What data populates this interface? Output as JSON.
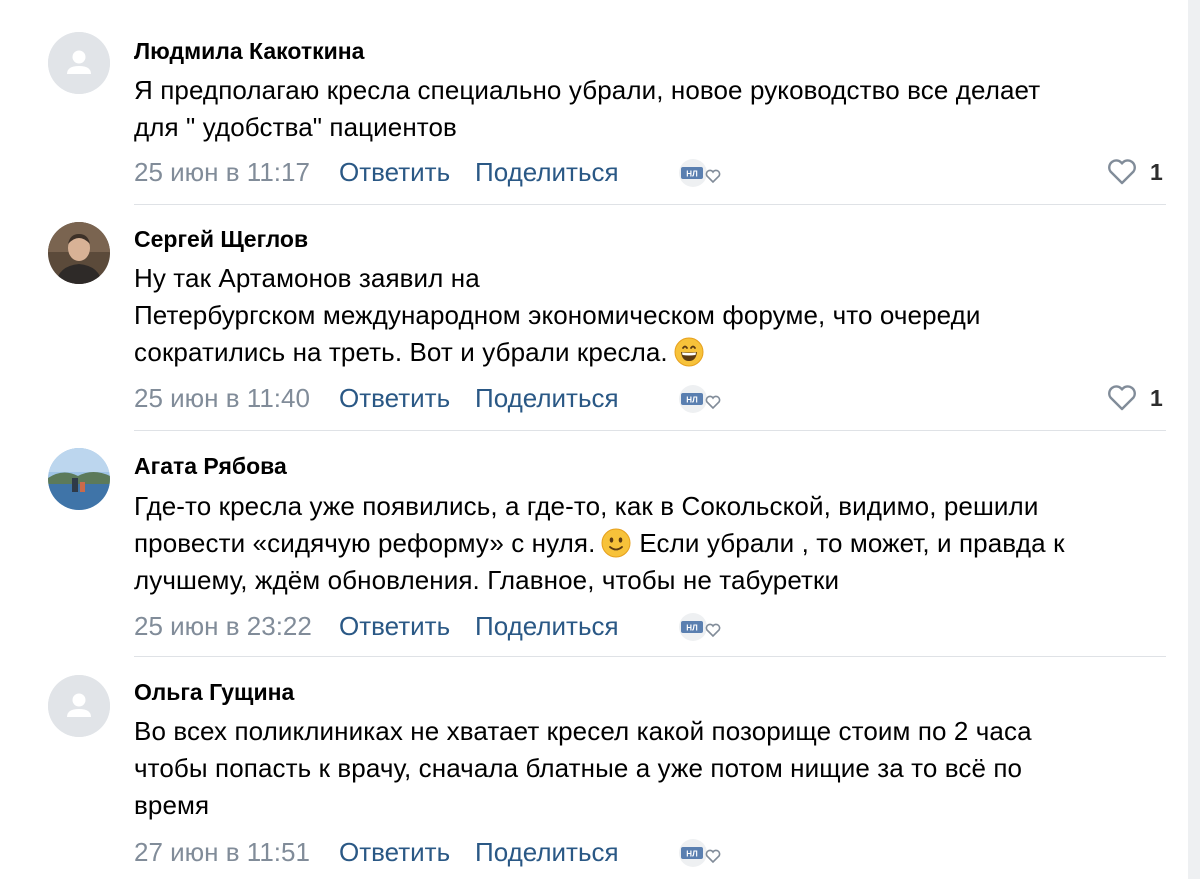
{
  "comments": [
    {
      "author": "Людмила Какоткина",
      "avatar": "default-avatar-icon",
      "lines": [
        "Я предполагаю кресла специально убрали, новое руководство все делает",
        "для \" удобства\" пациентов"
      ],
      "date": "25 июн в 11:17",
      "reply_label": "Ответить",
      "share_label": "Поделиться",
      "likes": "1"
    },
    {
      "author": "Сергей Щеглов",
      "avatar": "user-photo-avatar",
      "lines": [
        "Ну так Артамонов заявил на",
        "Петербургском международном экономическом форуме, что очереди",
        "сократились на треть. Вот и убрали кресла."
      ],
      "emoji": "grinning-face-emoji",
      "date": "25 июн в 11:40",
      "reply_label": "Ответить",
      "share_label": "Поделиться",
      "likes": "1"
    },
    {
      "author": "Агата Рябова",
      "avatar": "landscape-photo-avatar",
      "lines": [
        "Где-то кресла уже появились, а где-то, как в Сокольской, видимо, решили",
        "провести «сидячую реформу» с нуля.",
        "лучшему, ждём обновления. Главное, чтобы не табуретки"
      ],
      "line2_after_emoji": "Если убрали , то может, и правда к",
      "emoji": "slightly-smiling-face-emoji",
      "date": "25 июн в 23:22",
      "reply_label": "Ответить",
      "share_label": "Поделиться"
    },
    {
      "author": "Ольга Гущина",
      "avatar": "default-avatar-icon",
      "lines": [
        "Во всех поликлиниках не хватает кресел какой позорище стоим по 2 часа",
        "чтобы попасть к врачу, сначала блатные а уже потом нищие за то всё по",
        "время"
      ],
      "date": "27 июн в 11:51",
      "reply_label": "Ответить",
      "share_label": "Поделиться"
    }
  ],
  "icons": {
    "like": "heart-outline-icon",
    "badge": "nl-heart-badge-icon"
  },
  "colors": {
    "link": "#2a5885",
    "meta": "#818c99",
    "divider": "#dfe2e6"
  }
}
